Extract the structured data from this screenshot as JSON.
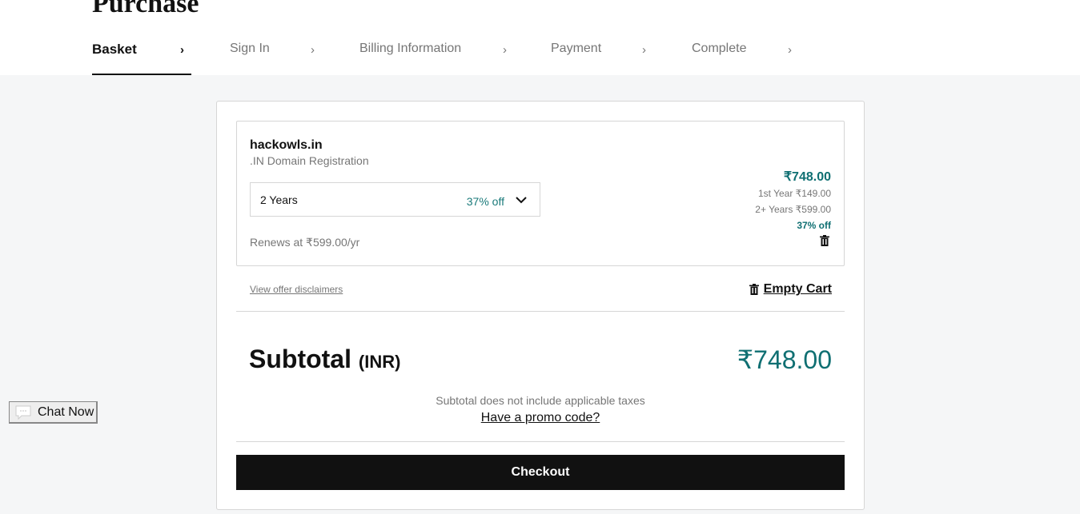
{
  "page": {
    "title": "Purchase"
  },
  "steps": [
    {
      "label": "Basket",
      "active": true
    },
    {
      "label": "Sign In",
      "active": false
    },
    {
      "label": "Billing Information",
      "active": false
    },
    {
      "label": "Payment",
      "active": false
    },
    {
      "label": "Complete",
      "active": false
    }
  ],
  "step_chevron": "›",
  "cart_item": {
    "domain": "hackowls.in",
    "product": ".IN Domain Registration",
    "term": {
      "selected": "2 Years",
      "discount": "37% off"
    },
    "renews": "Renews at ₹599.00/yr",
    "price": "₹748.00",
    "first_year": "1st Year ₹149.00",
    "renewal_years": "2+ Years ₹599.00",
    "discount": "37% off"
  },
  "links": {
    "disclaimers": "View offer disclaimers",
    "empty_cart": "Empty Cart",
    "promo": "Have a promo code?"
  },
  "subtotal": {
    "label": "Subtotal",
    "currency": "(INR)",
    "value": "₹748.00",
    "note": "Subtotal does not include applicable taxes"
  },
  "checkout_label": "Checkout",
  "chat": {
    "label": "Chat Now"
  },
  "colors": {
    "accent": "#0f6f72",
    "primary_button": "#111111"
  }
}
